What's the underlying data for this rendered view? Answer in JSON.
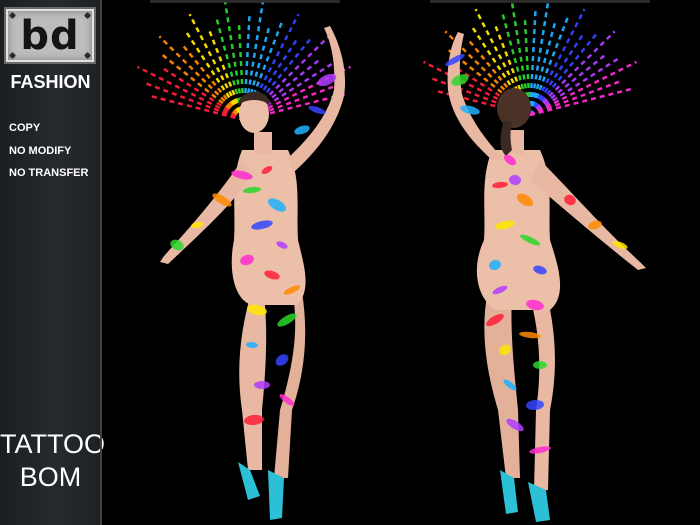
{
  "logo": {
    "text": "bd"
  },
  "brand": "FASHION",
  "permissions": [
    "COPY",
    "NO MODIFY",
    "NO TRANSFER"
  ],
  "product": {
    "line1": "TATTOO",
    "line2": "BOM"
  },
  "colors": {
    "background": "#000000",
    "sidebar": "#23272b",
    "skin": "#e8b8a2",
    "shoes": "#2bc0d6",
    "rainbow": [
      "#ff1f3a",
      "#ff8a00",
      "#ffe600",
      "#2bd62b",
      "#1fb0ff",
      "#3344ff",
      "#b03cff",
      "#ff2bd0"
    ]
  },
  "icons": [
    "rivet-icon"
  ]
}
